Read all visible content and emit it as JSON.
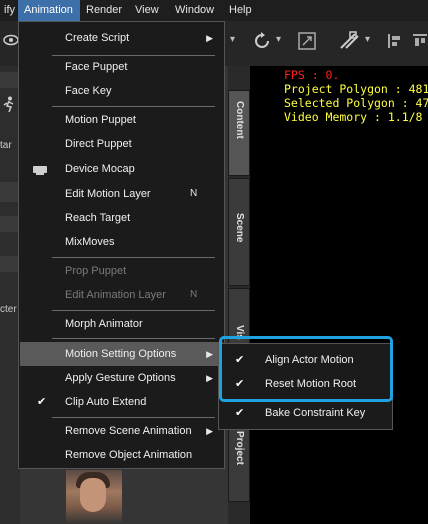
{
  "menubar": {
    "items": [
      "ify",
      "Animation",
      "Render",
      "View",
      "Window",
      "Help"
    ],
    "active_index": 1
  },
  "left_panel": {
    "fragments": [
      "tar",
      "cter"
    ]
  },
  "vertical_tabs": [
    "Content",
    "Scene",
    "Vis",
    "Project"
  ],
  "viewport_stats": {
    "fps": "FPS : 0.",
    "project_polygon": "Project Polygon : 481",
    "selected_polygon": "Selected Polygon : 47",
    "video_memory": "Video Memory : 1.1/8",
    "colors": {
      "fps": "#ff2020",
      "stats": "#ffff40"
    }
  },
  "animation_menu": {
    "items": [
      {
        "label": "Create Script",
        "submenu": true
      },
      {
        "label": "Face Puppet"
      },
      {
        "label": "Face Key"
      },
      {
        "label": "Motion Puppet"
      },
      {
        "label": "Direct Puppet"
      },
      {
        "label": "Device Mocap",
        "icon": "device-icon"
      },
      {
        "label": "Edit Motion Layer",
        "shortcut": "N"
      },
      {
        "label": "Reach Target"
      },
      {
        "label": "MixMoves"
      },
      {
        "label": "Prop Puppet",
        "disabled": true
      },
      {
        "label": "Edit Animation Layer",
        "shortcut": "N",
        "disabled": true
      },
      {
        "label": "Morph Animator"
      },
      {
        "label": "Motion Setting Options",
        "submenu": true,
        "highlighted": true
      },
      {
        "label": "Apply Gesture Options",
        "submenu": true
      },
      {
        "label": "Clip Auto Extend",
        "checked": true
      },
      {
        "label": "Remove  Scene Animation",
        "submenu": true
      },
      {
        "label": "Remove Object  Animation"
      }
    ]
  },
  "motion_setting_submenu": {
    "items": [
      {
        "label": "Align Actor Motion",
        "checked": true
      },
      {
        "label": "Reset Motion Root",
        "checked": true
      },
      {
        "label": "Bake Constraint Key",
        "checked": true
      }
    ],
    "focus_color": "#1fa2e0"
  }
}
